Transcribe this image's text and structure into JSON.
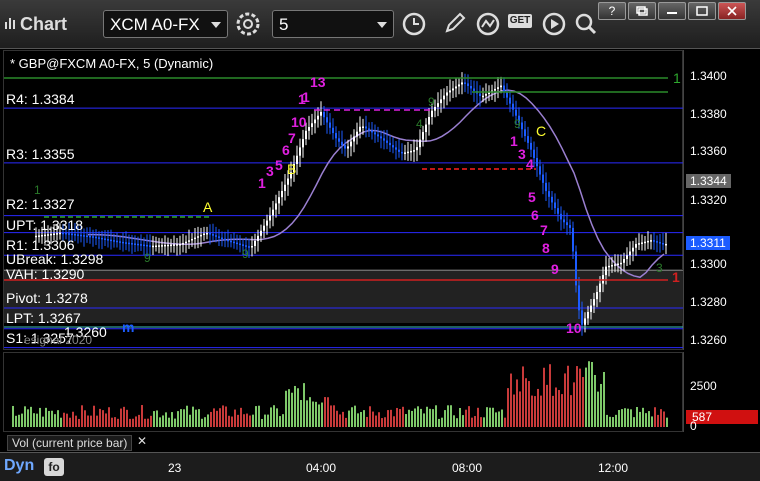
{
  "toolbar": {
    "app_title": "Chart",
    "symbol": "XCM A0-FX",
    "interval": "5",
    "get_label": "GET"
  },
  "chart": {
    "header": "* GBP@FXCM A0-FX, 5 (Dynamic)",
    "levels": [
      {
        "label": "R4: 1.3384"
      },
      {
        "label": "R3: 1.3355"
      },
      {
        "label": "R2: 1.3327"
      },
      {
        "label": "UPT: 1.3318"
      },
      {
        "label": "R1: 1.3306"
      },
      {
        "label": "UBreak: 1.3298"
      },
      {
        "label": "VAH: 1.3290"
      },
      {
        "label": "Pivot: 1.3278"
      },
      {
        "label": "LPT: 1.3267"
      },
      {
        "label": "S1: 1.3257"
      }
    ],
    "overlay_texts": [
      "1.3260",
      "m",
      "esignal 2020"
    ],
    "price_axis": [
      "1.3400",
      "1.3380",
      "1.3360",
      "1.3344",
      "1.3320",
      "1.3311",
      "1.3300",
      "1.3280",
      "1.3260"
    ],
    "current_price": "1.3311",
    "ma_price": "1.3344",
    "time_axis": [
      "23",
      "04:00",
      "08:00",
      "12:00"
    ],
    "sequence_numbers": [
      "1",
      "13",
      "1",
      "10",
      "7",
      "6",
      "5",
      "3",
      "1",
      "B",
      "A",
      "C",
      "1",
      "3",
      "4",
      "5",
      "6",
      "7",
      "8",
      "9",
      "10",
      "1"
    ],
    "green_labels": [
      "1",
      "9",
      "1",
      "9",
      "9",
      "4",
      "9",
      "3"
    ]
  },
  "volume": {
    "label": "Vol (current price bar)",
    "axis": [
      "2500",
      "0"
    ],
    "current": "587"
  },
  "footer": {
    "dyn_label": "Dyn"
  },
  "colors": {
    "up_bar": "#ffffff",
    "down_bar": "#1c5cff",
    "ma": "#9a7fd0",
    "vol_up": "#7ec86a",
    "vol_down": "#c83a3a"
  }
}
